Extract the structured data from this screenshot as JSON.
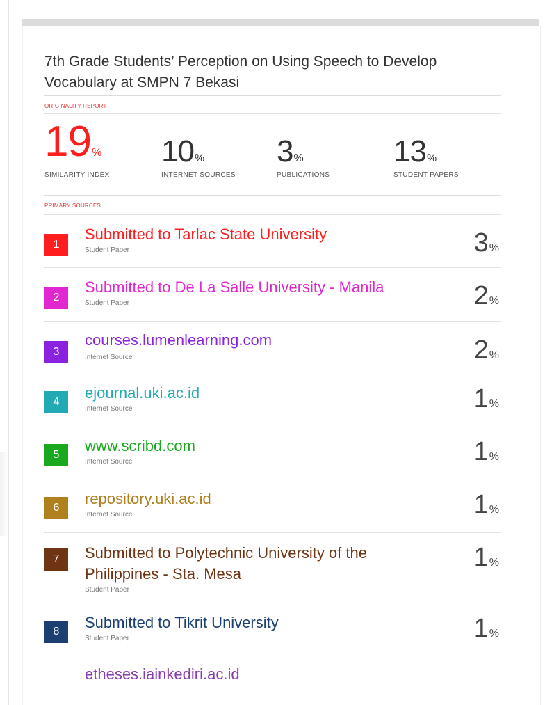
{
  "title": "7th Grade Students’ Perception on Using Speech to Develop Vocabulary at SMPN 7 Bekasi",
  "labels": {
    "originality_report": "ORIGINALITY REPORT",
    "primary_sources": "PRIMARY SOURCES"
  },
  "metrics": [
    {
      "value": "19",
      "unit": "%",
      "label": "SIMILARITY INDEX"
    },
    {
      "value": "10",
      "unit": "%",
      "label": "INTERNET SOURCES"
    },
    {
      "value": "3",
      "unit": "%",
      "label": "PUBLICATIONS"
    },
    {
      "value": "13",
      "unit": "%",
      "label": "STUDENT PAPERS"
    }
  ],
  "sources": [
    {
      "num": "1",
      "title": "Submitted to Tarlac State University",
      "type": "Student Paper",
      "pct": "3",
      "unit": "%",
      "color": "#ff1e1e"
    },
    {
      "num": "2",
      "title": "Submitted to De La Salle University - Manila",
      "type": "Student Paper",
      "pct": "2",
      "unit": "%",
      "color": "#e027d0"
    },
    {
      "num": "3",
      "title": "courses.lumenlearning.com",
      "type": "Internet Source",
      "pct": "2",
      "unit": "%",
      "color": "#8a22e0"
    },
    {
      "num": "4",
      "title": "ejournal.uki.ac.id",
      "type": "Internet Source",
      "pct": "1",
      "unit": "%",
      "color": "#22aab4"
    },
    {
      "num": "5",
      "title": "www.scribd.com",
      "type": "Internet Source",
      "pct": "1",
      "unit": "%",
      "color": "#19a81e"
    },
    {
      "num": "6",
      "title": "repository.uki.ac.id",
      "type": "Internet Source",
      "pct": "1",
      "unit": "%",
      "color": "#b07f1e"
    },
    {
      "num": "7",
      "title": "Submitted to Polytechnic University of the Philippines - Sta. Mesa",
      "type": "Student Paper",
      "pct": "1",
      "unit": "%",
      "color": "#6e3414"
    },
    {
      "num": "8",
      "title": "Submitted to Tikrit University",
      "type": "Student Paper",
      "pct": "1",
      "unit": "%",
      "color": "#1b3f70"
    }
  ],
  "partial_source": {
    "title": "etheses.iainkediri.ac.id",
    "color": "#8a3bb0"
  }
}
